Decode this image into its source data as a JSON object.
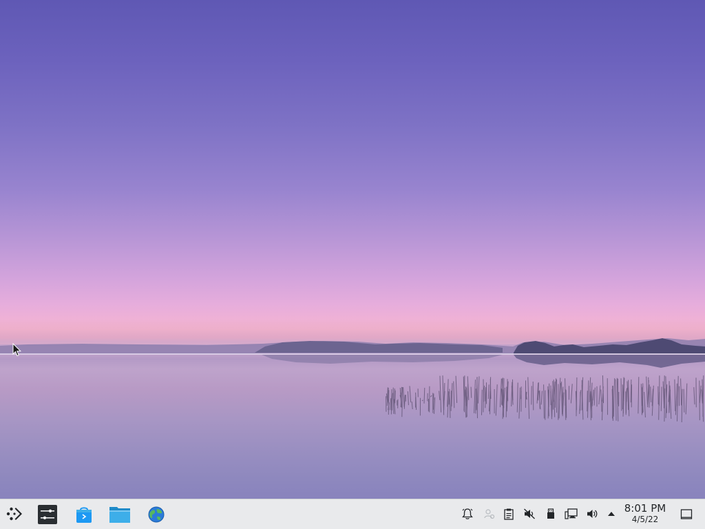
{
  "desktop": {
    "wallpaper": "lake-sunset-wallpaper"
  },
  "taskbar": {
    "launcher_icon": "application-launcher-icon",
    "apps": [
      {
        "name": "system-settings-icon",
        "color": "#2a2e32"
      },
      {
        "name": "discover-icon",
        "color": "#1d99f3"
      },
      {
        "name": "dolphin-file-manager-icon",
        "color": "#3daee9"
      },
      {
        "name": "web-browser-icon",
        "color": "#2b7bd8"
      }
    ],
    "tray_icons": [
      "notifications-bell-icon",
      "kde-connect-icon",
      "clipboard-icon",
      "speaker-muted-icon",
      "usb-device-icon",
      "network-wired-icon",
      "volume-icon",
      "expand-tray-arrow-icon"
    ],
    "clock": {
      "time": "8:01 PM",
      "date": "4/5/22"
    },
    "show_desktop_icon": "show-desktop-icon"
  },
  "colors": {
    "taskbar_bg": "#e9eaec",
    "icon_dark": "#232629",
    "accent": "#3daee9"
  }
}
